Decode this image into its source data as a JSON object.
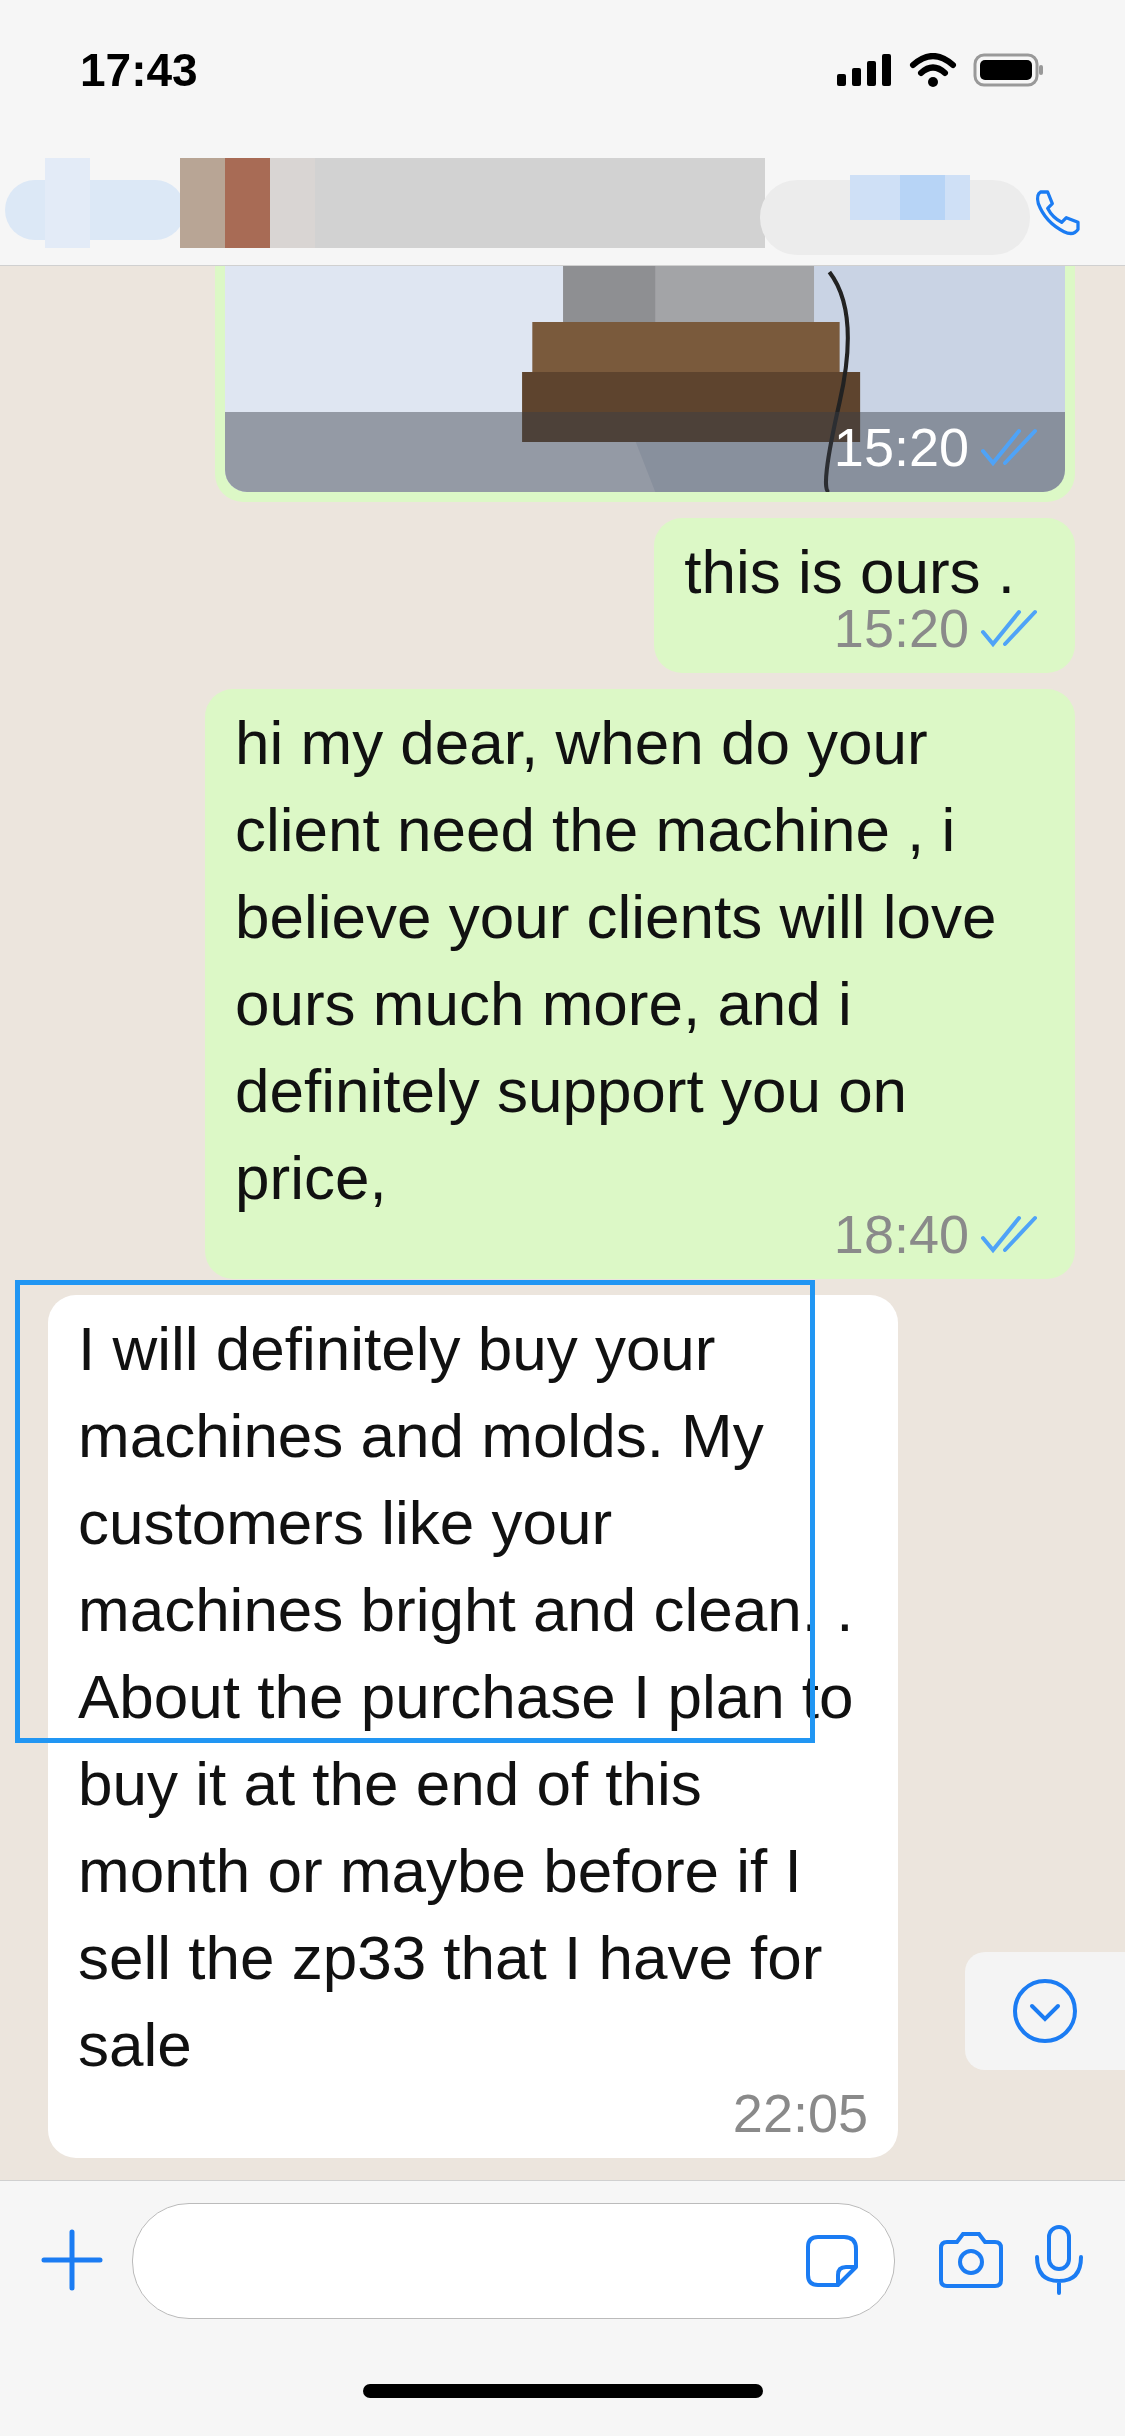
{
  "status_bar": {
    "time": "17:43"
  },
  "messages": [
    {
      "sent": true,
      "time": "15:20",
      "read": true
    },
    {
      "kind": "text",
      "sent": true,
      "text": "this is ours .",
      "time": "15:20",
      "read": true
    },
    {
      "kind": "text",
      "sent": true,
      "text": "hi my dear, when do your client need the machine , i believe your clients will love ours much more, and i definitely support you on price,",
      "time": "18:40",
      "read": true
    },
    {
      "kind": "text",
      "sent": false,
      "text": "I will definitely buy your machines and molds. My customers like your machines bright and clean. . About the purchase I plan to buy it at the end of this month or maybe before if I sell the zp33 that I have for sale",
      "time": "22:05",
      "highlighted": true
    }
  ]
}
